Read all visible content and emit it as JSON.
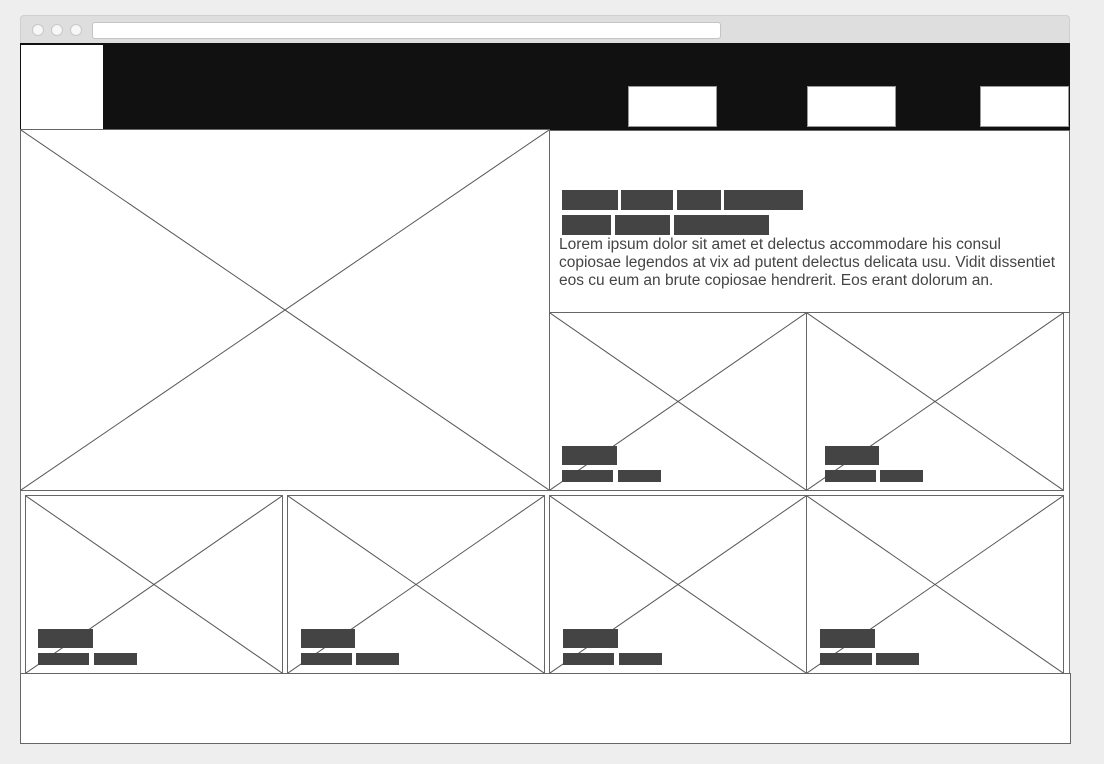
{
  "browser": {
    "url": ""
  },
  "hero": {
    "paragraph": "Lorem ipsum dolor sit amet et delectus accommodare his consul copiosae legendos at vix ad putent delectus delicata usu. Vidit dissentiet eos cu eum an brute copiosae hendrerit. Eos erant dolorum an."
  },
  "colors": {
    "header_background": "#111111",
    "placeholder_block": "#444444",
    "page_background": "#eeeeee"
  }
}
